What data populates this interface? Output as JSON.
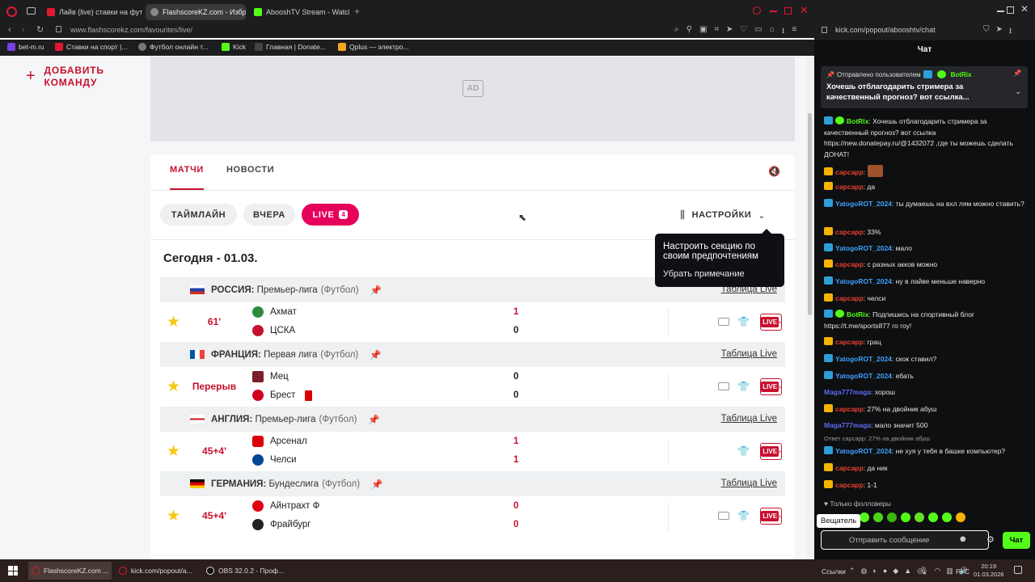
{
  "browser_left": {
    "tabs": [
      {
        "label": "Лайв (live) ставки на фут",
        "active": false
      },
      {
        "label": "FlashscoreKZ.com - Избр",
        "active": true
      },
      {
        "label": "AbooshTV Stream - Watch",
        "active": false
      }
    ],
    "url": "www.flashscorekz.com/favourites/live/",
    "bookmarks": [
      "bet-m.ru",
      "Ставки на спорт |...",
      "Футбол онлайн т...",
      "Kick",
      "Главная | Donate...",
      "Qplus — электро..."
    ]
  },
  "sidebar": {
    "add_team": "ДОБАВИТЬ КОМАНДУ"
  },
  "ad": {
    "badge": "AD"
  },
  "tabs": {
    "matches": "МАТЧИ",
    "news": "НОВОСТИ"
  },
  "filters": {
    "timeline": "ТАЙМЛАЙН",
    "yesterday": "ВЧЕРА",
    "live": "LIVE",
    "live_count": "4",
    "settings": "НАСТРОЙКИ"
  },
  "tooltip": {
    "text": "Настроить секцию по своим предпочтениям",
    "dismiss": "Убрать примечание"
  },
  "date_heading": "Сегодня - 01.03.",
  "table_live_label": "Таблица Live",
  "live_btn": "LIVE",
  "leagues": [
    {
      "country": "РОССИЯ:",
      "name": "Премьер-лига",
      "sport": "(Футбол)",
      "match": {
        "time": "61'",
        "home": "Ахмат",
        "away": "ЦСКА",
        "home_score": "1",
        "away_score": "0"
      }
    },
    {
      "country": "ФРАНЦИЯ:",
      "name": "Первая лига",
      "sport": "(Футбол)",
      "match": {
        "time": "Перерыв",
        "home": "Мец",
        "away": "Брест",
        "home_score": "0",
        "away_score": "0"
      }
    },
    {
      "country": "АНГЛИЯ:",
      "name": "Премьер-лига",
      "sport": "(Футбол)",
      "match": {
        "time": "45+4'",
        "home": "Арсенал",
        "away": "Челси",
        "home_score": "1",
        "away_score": "1"
      }
    },
    {
      "country": "ГЕРМАНИЯ:",
      "name": "Бундеслига",
      "sport": "(Футбол)",
      "match": {
        "time": "45+4'",
        "home": "Айнтрахт Ф",
        "away": "Фрайбург",
        "home_score": "0",
        "away_score": "0"
      }
    }
  ],
  "browser_right": {
    "url": "kick.com/popout/abooshtv/chat",
    "title": "Чат"
  },
  "chat": {
    "pinned_by": "Отправлено пользователем",
    "pinned_user": "BotRix",
    "pinned_text": "Хочешь отблагодарить стримера за качественный прогноз? вот ссылка...",
    "messages": [
      {
        "user": "BotRix",
        "text": ": Хочешь отблагодарить стримера за качественный прогноз? вот ссылка https://new.donatepay.ru/@1432072 ,где ты можешь сделать ДОНАТ!"
      },
      {
        "user": "сарсарр",
        "text": ":"
      },
      {
        "user": "сарсарр",
        "text": ": да"
      },
      {
        "user": "YatogoROT_2024",
        "text": ": ты думаешь на вхл лям можно ставить?"
      },
      {
        "user": "сарсарр",
        "text": ": 33%"
      },
      {
        "user": "YatogoROT_2024",
        "text": ": мало"
      },
      {
        "user": "сарсарр",
        "text": ": с разных акков можно"
      },
      {
        "user": "YatogoROT_2024",
        "text": ": ну в лайве меньше наверно"
      },
      {
        "user": "сарсарр",
        "text": ": челси"
      },
      {
        "user": "BotRix",
        "text": ": Подпишись на спортивный блог https://t.me/sports877 го гоу!"
      },
      {
        "user": "сарсарр",
        "text": ": грац"
      },
      {
        "user": "YatogoROT_2024",
        "text": ": скок ставил?"
      },
      {
        "user": "YatogoROT_2024",
        "text": ": ебать"
      },
      {
        "user": "Maga777maga",
        "text": ": хорош"
      },
      {
        "user": "сарсарр",
        "text": ": 27% на двойник абуш"
      },
      {
        "user": "Maga777maga",
        "text": ": мало значит 500"
      },
      {
        "user": "YatogoROT_2024",
        "text": ": не хуя у тебя в башке компьютер?"
      },
      {
        "user": "сарсарр",
        "text": ": да ник"
      },
      {
        "user": "сарсарр",
        "text": ": 1-1"
      }
    ],
    "reply_ref": "Ответ сарсарр: 27% на двойник абуш",
    "followers_only": "Только фолловеры",
    "broadcaster_tip": "Вещатель",
    "input_placeholder": "Отправить сообщение",
    "send_label": "Чат"
  },
  "taskbar": {
    "items": [
      "FlashscoreKZ.com ...",
      "kick.com/popout/a...",
      "OBS 32.0.2 - Проф..."
    ],
    "links": "Ссылки",
    "lang": "РУС",
    "time": "20:19",
    "date": "01.03.2026"
  }
}
